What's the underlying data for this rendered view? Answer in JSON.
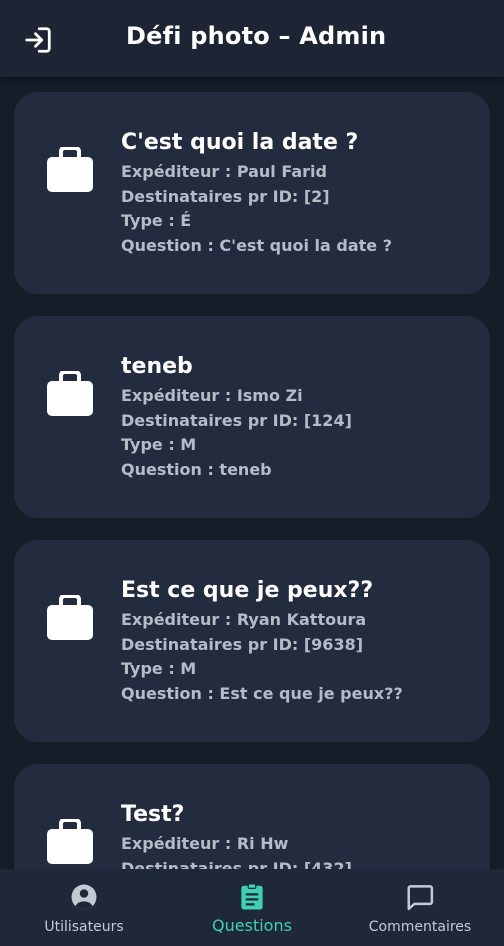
{
  "header": {
    "title": "Défi photo – Admin",
    "logout_icon": "logout-icon"
  },
  "questions": [
    {
      "title": "C'est quoi la date ?",
      "sender": "Expéditeur : Paul Farid",
      "recipients": "Destinataires pr ID: [2]",
      "type": "Type : É",
      "question": "Question : C'est quoi la date ?"
    },
    {
      "title": "teneb",
      "sender": "Expéditeur : Ismo Zi",
      "recipients": "Destinataires pr ID: [124]",
      "type": "Type : M",
      "question": "Question : teneb"
    },
    {
      "title": "Est ce que je peux??",
      "sender": "Expéditeur : Ryan Kattoura",
      "recipients": "Destinataires pr ID: [9638]",
      "type": "Type : M",
      "question": "Question : Est ce que je peux??"
    },
    {
      "title": "Test?",
      "sender": "Expéditeur : Ri Hw",
      "recipients": "Destinataires pr ID: [432]",
      "type": "",
      "question": ""
    }
  ],
  "bottom_nav": {
    "items": [
      {
        "label": "Utilisateurs",
        "icon": "account-circle-icon",
        "active": false
      },
      {
        "label": "Questions",
        "icon": "assignment-icon",
        "active": true
      },
      {
        "label": "Commentaires",
        "icon": "chat-bubble-icon",
        "active": false
      }
    ]
  },
  "colors": {
    "background": "#161d29",
    "card": "#232c3e",
    "accent": "#3fd0b6",
    "text_primary": "#ffffff",
    "text_secondary": "#b5bcc8"
  }
}
